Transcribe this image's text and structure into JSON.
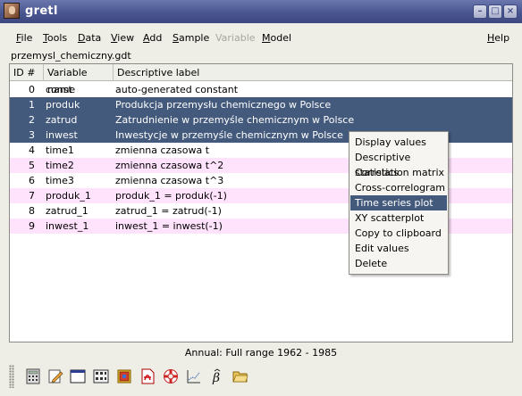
{
  "window": {
    "title": "gretl"
  },
  "menu": [
    {
      "label": "File",
      "u": "F",
      "rest": "ile",
      "disabled": false
    },
    {
      "label": "Tools",
      "u": "T",
      "rest": "ools",
      "disabled": false
    },
    {
      "label": "Data",
      "u": "D",
      "rest": "ata",
      "disabled": false
    },
    {
      "label": "View",
      "u": "V",
      "rest": "iew",
      "disabled": false
    },
    {
      "label": "Add",
      "u": "A",
      "rest": "dd",
      "disabled": false
    },
    {
      "label": "Sample",
      "u": "S",
      "rest": "ample",
      "disabled": false
    },
    {
      "label": "Variable",
      "u": "",
      "rest": "Variable",
      "disabled": true
    },
    {
      "label": "Model",
      "u": "M",
      "rest": "odel",
      "disabled": false
    },
    {
      "label": "Help",
      "u": "H",
      "rest": "elp",
      "disabled": false
    }
  ],
  "filename": "przemysl_chemiczny.gdt",
  "table": {
    "headers": {
      "id": "ID #",
      "name": "Variable name",
      "label": "Descriptive label"
    },
    "rows": [
      {
        "id": "0",
        "name": "const",
        "label": "auto-generated constant",
        "state": "normal"
      },
      {
        "id": "1",
        "name": "produk",
        "label": "Produkcja przemysłu chemicznego w Polsce",
        "state": "selected"
      },
      {
        "id": "2",
        "name": "zatrud",
        "label": "Zatrudnienie w przemyśle chemicznym w Polsce",
        "state": "selected"
      },
      {
        "id": "3",
        "name": "inwest",
        "label": "Inwestycje w przemyśle chemicznym w Polsce",
        "state": "selected"
      },
      {
        "id": "4",
        "name": "time1",
        "label": "zmienna czasowa t",
        "state": "normal"
      },
      {
        "id": "5",
        "name": "time2",
        "label": "zmienna czasowa t^2",
        "state": "alt"
      },
      {
        "id": "6",
        "name": "time3",
        "label": "zmienna czasowa t^3",
        "state": "normal"
      },
      {
        "id": "7",
        "name": "produk_1",
        "label": "produk_1 = produk(-1)",
        "state": "alt"
      },
      {
        "id": "8",
        "name": "zatrud_1",
        "label": "zatrud_1 = zatrud(-1)",
        "state": "normal"
      },
      {
        "id": "9",
        "name": "inwest_1",
        "label": "inwest_1 = inwest(-1)",
        "state": "alt"
      }
    ]
  },
  "context_menu": {
    "items": [
      "Display values",
      "Descriptive statistics",
      "Correlation matrix",
      "Cross-correlogram",
      "Time series plot",
      "XY scatterplot",
      "Copy to clipboard",
      "Edit values",
      "Delete"
    ],
    "highlighted": "Time series plot"
  },
  "status": "Annual: Full range 1962 - 1985",
  "toolbar": [
    "calculator-icon",
    "edit-script-icon",
    "console-window-icon",
    "session-icons-icon",
    "function-package-icon",
    "pdf-help-icon",
    "lifebuoy-help-icon",
    "command-log-icon",
    "ols-beta-icon",
    "open-folder-icon"
  ],
  "colors": {
    "selection": "#445a7c",
    "alt_row": "#ffe2fb",
    "titlebar": "#4a5690"
  }
}
